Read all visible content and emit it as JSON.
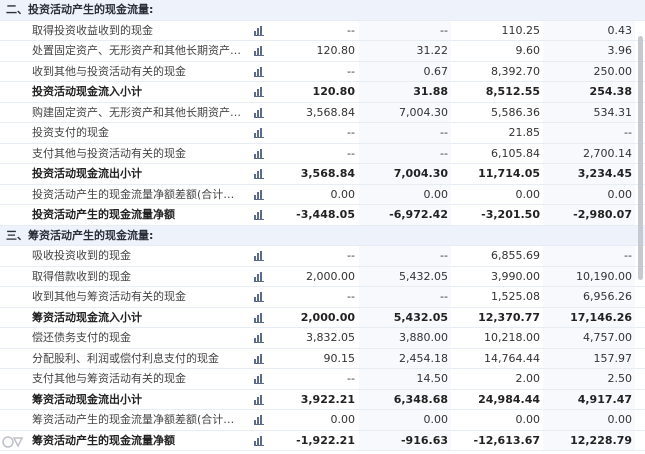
{
  "rows": [
    {
      "type": "section",
      "label": "二、投资活动产生的现金流量:",
      "values": [
        "",
        "",
        "",
        ""
      ]
    },
    {
      "type": "item",
      "label": "取得投资收益收到的现金",
      "values": [
        "--",
        "--",
        "110.25",
        "0.43"
      ]
    },
    {
      "type": "item",
      "label": "处置固定资产、无形资产和其他长期资产收回的...",
      "values": [
        "120.80",
        "31.22",
        "9.60",
        "3.96"
      ]
    },
    {
      "type": "item",
      "label": "收到其他与投资活动有关的现金",
      "values": [
        "--",
        "0.67",
        "8,392.70",
        "250.00"
      ]
    },
    {
      "type": "bold",
      "label": "投资活动现金流入小计",
      "values": [
        "120.80",
        "31.88",
        "8,512.55",
        "254.38"
      ]
    },
    {
      "type": "item",
      "label": "购建固定资产、无形资产和其他长期资产支付的...",
      "values": [
        "3,568.84",
        "7,004.30",
        "5,586.36",
        "534.31"
      ]
    },
    {
      "type": "item",
      "label": "投资支付的现金",
      "values": [
        "--",
        "--",
        "21.85",
        "--"
      ]
    },
    {
      "type": "item",
      "label": "支付其他与投资活动有关的现金",
      "values": [
        "--",
        "--",
        "6,105.84",
        "2,700.14"
      ]
    },
    {
      "type": "bold",
      "label": "投资活动现金流出小计",
      "values": [
        "3,568.84",
        "7,004.30",
        "11,714.05",
        "3,234.45"
      ]
    },
    {
      "type": "item",
      "label": "投资活动产生的现金流量净额差额(合计平衡项目)",
      "values": [
        "0.00",
        "0.00",
        "0.00",
        "0.00"
      ]
    },
    {
      "type": "bold",
      "label": "投资活动产生的现金流量净额",
      "values": [
        "-3,448.05",
        "-6,972.42",
        "-3,201.50",
        "-2,980.07"
      ],
      "green": [
        true,
        true,
        true,
        true
      ]
    },
    {
      "type": "section",
      "label": "三、筹资活动产生的现金流量:",
      "values": [
        "",
        "",
        "",
        ""
      ]
    },
    {
      "type": "item",
      "label": "吸收投资收到的现金",
      "values": [
        "--",
        "--",
        "6,855.69",
        "--"
      ]
    },
    {
      "type": "item",
      "label": "取得借款收到的现金",
      "values": [
        "2,000.00",
        "5,432.05",
        "3,990.00",
        "10,190.00"
      ]
    },
    {
      "type": "item",
      "label": "收到其他与筹资活动有关的现金",
      "values": [
        "--",
        "--",
        "1,525.08",
        "6,956.26"
      ]
    },
    {
      "type": "bold",
      "label": "筹资活动现金流入小计",
      "values": [
        "2,000.00",
        "5,432.05",
        "12,370.77",
        "17,146.26"
      ]
    },
    {
      "type": "item",
      "label": "偿还债务支付的现金",
      "values": [
        "3,832.05",
        "3,880.00",
        "10,218.00",
        "4,757.00"
      ]
    },
    {
      "type": "item",
      "label": "分配股利、利润或偿付利息支付的现金",
      "values": [
        "90.15",
        "2,454.18",
        "14,764.44",
        "157.97"
      ]
    },
    {
      "type": "item",
      "label": "支付其他与筹资活动有关的现金",
      "values": [
        "--",
        "14.50",
        "2.00",
        "2.50"
      ]
    },
    {
      "type": "bold",
      "label": "筹资活动现金流出小计",
      "values": [
        "3,922.21",
        "6,348.68",
        "24,984.44",
        "4,917.47"
      ]
    },
    {
      "type": "item",
      "label": "筹资活动产生的现金流量净额差额(合计平衡项目)",
      "values": [
        "0.00",
        "0.00",
        "0.00",
        "0.00"
      ]
    },
    {
      "type": "bold",
      "label": "筹资活动产生的现金流量净额",
      "values": [
        "-1,922.21",
        "-916.63",
        "-12,613.67",
        "12,228.79"
      ],
      "green": [
        true,
        true,
        true,
        true
      ]
    }
  ],
  "icons": {
    "row_chart": "bar-chart-icon"
  },
  "colors": {
    "accent_green": "#1e9b4d",
    "section_bg": "#eef2fb",
    "grid": "#e8ecf3",
    "chart_icon": "#5b6b8c"
  }
}
